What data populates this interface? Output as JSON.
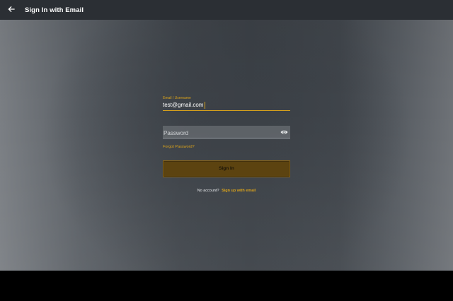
{
  "appbar": {
    "title": "Sign In with Email",
    "back_icon": "arrow-left-icon"
  },
  "form": {
    "email": {
      "label": "Email / Username",
      "value": "test@gmail.com"
    },
    "password": {
      "placeholder": "Password",
      "value": "",
      "visibility_icon": "eye-icon"
    },
    "forgot_label": "Forgot Password?",
    "signin_label": "Sign In",
    "signup_prompt": "No account?",
    "signup_link": "Sign up with email"
  },
  "colors": {
    "accent": "#d9a21b",
    "appbar": "#2b2f34",
    "button": "#5c4310"
  }
}
